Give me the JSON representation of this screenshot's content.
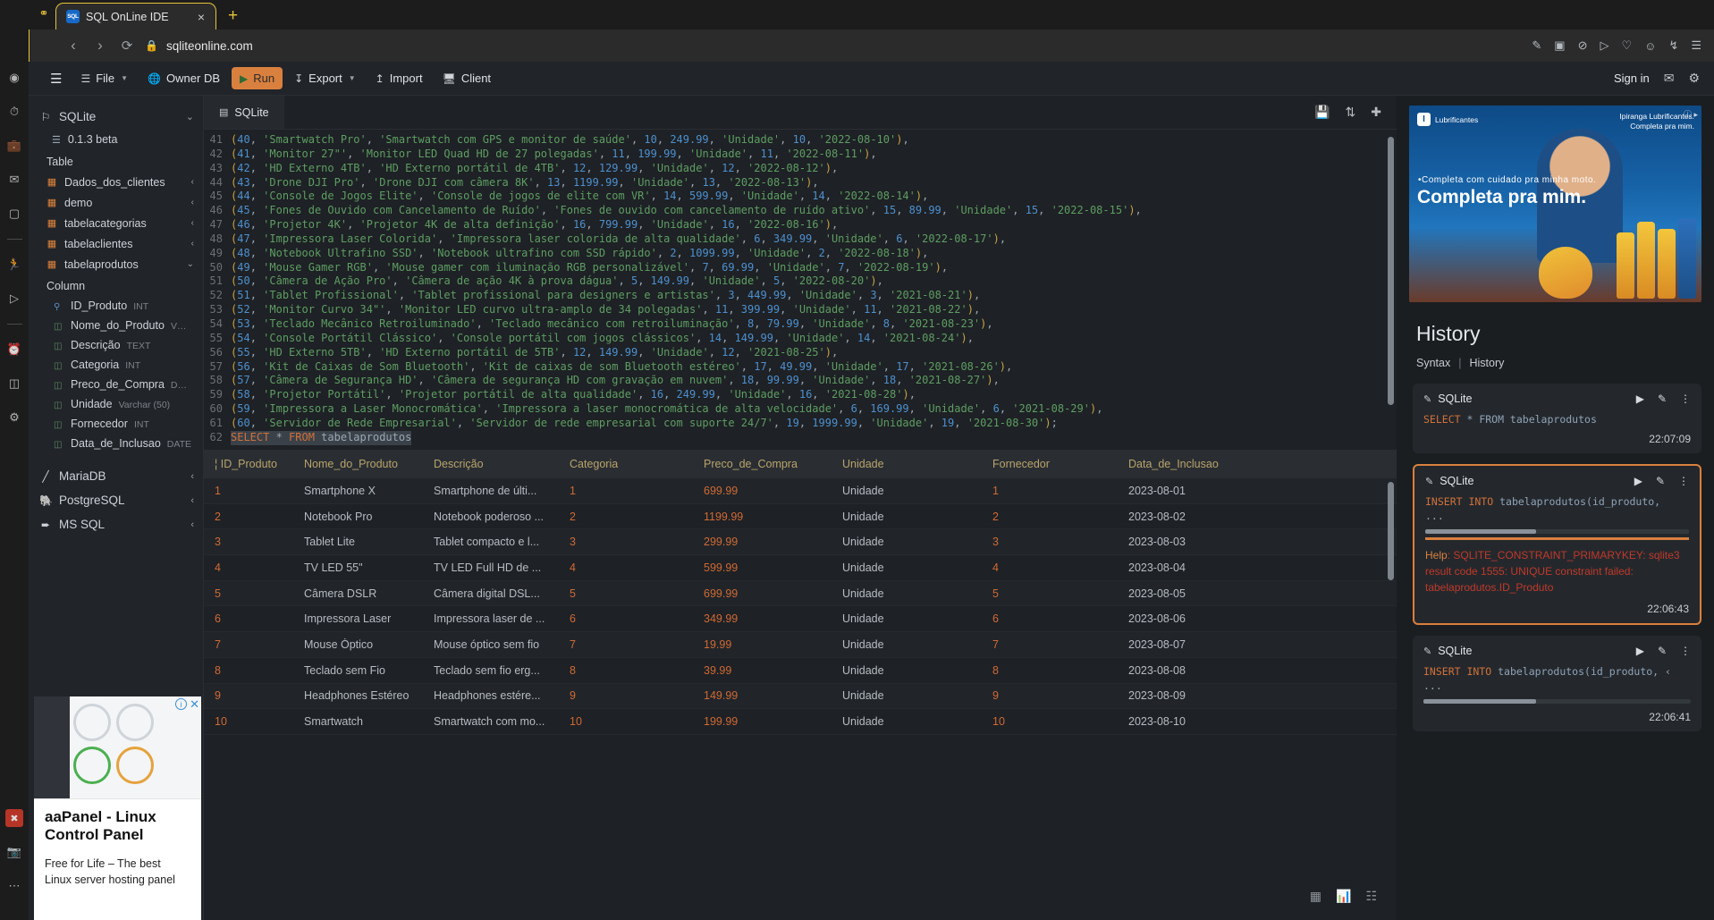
{
  "browser": {
    "tab": {
      "title": "SQL OnLine IDE",
      "favicon_text": "SQL",
      "close_icon": "×"
    },
    "new_tab_icon": "+",
    "left_icon": "bookmarks-icon",
    "nav": {
      "back": "‹",
      "forward": "›",
      "reload": "⟳",
      "lock": "🔒"
    },
    "url": "sqliteonline.com",
    "actions": [
      "edit-icon",
      "image-icon",
      "block-icon",
      "cast-icon",
      "send-icon",
      "heart-icon",
      "profile-icon",
      "download-icon",
      "menu-icon"
    ]
  },
  "launcher": {
    "items": [
      "opera-icon",
      "speed-dial-icon",
      "suitcase-icon",
      "messenger-icon",
      "instagram-icon",
      "divider",
      "fitness-icon",
      "player-icon",
      "divider2",
      "clock-icon",
      "cube-icon",
      "settings-icon"
    ],
    "bottom": [
      "red-icon",
      "camera-icon",
      "more-icon"
    ]
  },
  "toolbar": {
    "hamburger_icon": "☰",
    "file_label": "File",
    "owner_db_label": "Owner DB",
    "run_label": "Run",
    "export_label": "Export",
    "import_label": "Import",
    "client_label": "Client",
    "sign_in_label": "Sign in",
    "mail_icon": "✉",
    "gear_icon": "⚙"
  },
  "sidebar": {
    "database": {
      "name": "SQLite",
      "icon": "flag-icon",
      "chevron": "⌄"
    },
    "version": {
      "label": "0.1.3 beta",
      "icon": "schema-icon"
    },
    "table_section_label": "Table",
    "tables": [
      {
        "name": "Dados_dos_clientes",
        "expanded": false,
        "chevron": "‹"
      },
      {
        "name": "demo",
        "expanded": false,
        "chevron": "‹"
      },
      {
        "name": "tabelacategorias",
        "expanded": false,
        "chevron": "‹"
      },
      {
        "name": "tabelaclientes",
        "expanded": false,
        "chevron": "‹"
      },
      {
        "name": "tabelaprodutos",
        "expanded": true,
        "chevron": "⌄"
      }
    ],
    "column_section_label": "Column",
    "columns": [
      {
        "name": "ID_Produto",
        "type": "INT",
        "key": true
      },
      {
        "name": "Nome_do_Produto",
        "type": "V…",
        "key": false
      },
      {
        "name": "Descrição",
        "type": "TEXT",
        "key": false
      },
      {
        "name": "Categoria",
        "type": "INT",
        "key": false
      },
      {
        "name": "Preco_de_Compra",
        "type": "D…",
        "key": false
      },
      {
        "name": "Unidade",
        "type": "Varchar (50)",
        "key": false
      },
      {
        "name": "Fornecedor",
        "type": "INT",
        "key": false
      },
      {
        "name": "Data_de_Inclusao",
        "type": "DATE",
        "key": false
      }
    ],
    "other_databases": [
      {
        "name": "MariaDB",
        "icon": "mariadb-icon",
        "chevron": "‹"
      },
      {
        "name": "PostgreSQL",
        "icon": "postgres-icon",
        "chevron": "‹"
      },
      {
        "name": "MS SQL",
        "icon": "mssql-icon",
        "chevron": "‹"
      }
    ],
    "ad": {
      "title": "aaPanel - Linux Control Panel",
      "subtitle": "Free for Life – The best Linux server hosting panel",
      "info_icon": "i",
      "close_icon": "✕"
    }
  },
  "editor": {
    "tab_label": "SQLite",
    "tab_icon": "db-icon",
    "tab_actions": [
      "save-icon",
      "refresh-icon",
      "add-icon"
    ],
    "lines": [
      {
        "n": 41,
        "text": "(40, 'Smartwatch Pro', 'Smartwatch com GPS e monitor de saúde', 10, 249.99, 'Unidade', 10, '2022-08-10'),"
      },
      {
        "n": 42,
        "text": "(41, 'Monitor 27\"', 'Monitor LED Quad HD de 27 polegadas', 11, 199.99, 'Unidade', 11, '2022-08-11'),"
      },
      {
        "n": 43,
        "text": "(42, 'HD Externo 4TB', 'HD Externo portátil de 4TB', 12, 129.99, 'Unidade', 12, '2022-08-12'),"
      },
      {
        "n": 44,
        "text": "(43, 'Drone DJI Pro', 'Drone DJI com câmera 8K', 13, 1199.99, 'Unidade', 13, '2022-08-13'),"
      },
      {
        "n": 45,
        "text": "(44, 'Console de Jogos Elite', 'Console de jogos de elite com VR', 14, 599.99, 'Unidade', 14, '2022-08-14'),"
      },
      {
        "n": 46,
        "text": "(45, 'Fones de Ouvido com Cancelamento de Ruído', 'Fones de ouvido com cancelamento de ruído ativo', 15, 89.99, 'Unidade', 15, '2022-08-15'),"
      },
      {
        "n": 47,
        "text": "(46, 'Projetor 4K', 'Projetor 4K de alta definição', 16, 799.99, 'Unidade', 16, '2022-08-16'),"
      },
      {
        "n": 48,
        "text": "(47, 'Impressora Laser Colorida', 'Impressora laser colorida de alta qualidade', 6, 349.99, 'Unidade', 6, '2022-08-17'),"
      },
      {
        "n": 49,
        "text": "(48, 'Notebook Ultrafino SSD', 'Notebook ultrafino com SSD rápido', 2, 1099.99, 'Unidade', 2, '2022-08-18'),"
      },
      {
        "n": 50,
        "text": "(49, 'Mouse Gamer RGB', 'Mouse gamer com iluminação RGB personalizável', 7, 69.99, 'Unidade', 7, '2022-08-19'),"
      },
      {
        "n": 51,
        "text": "(50, 'Câmera de Ação Pro', 'Câmera de ação 4K à prova dágua', 5, 149.99, 'Unidade', 5, '2022-08-20'),"
      },
      {
        "n": 52,
        "text": "(51, 'Tablet Profissional', 'Tablet profissional para designers e artistas', 3, 449.99, 'Unidade', 3, '2021-08-21'),"
      },
      {
        "n": 53,
        "text": "(52, 'Monitor Curvo 34\"', 'Monitor LED curvo ultra-amplo de 34 polegadas', 11, 399.99, 'Unidade', 11, '2021-08-22'),"
      },
      {
        "n": 54,
        "text": "(53, 'Teclado Mecânico Retroiluminado', 'Teclado mecânico com retroiluminação', 8, 79.99, 'Unidade', 8, '2021-08-23'),"
      },
      {
        "n": 55,
        "text": "(54, 'Console Portátil Clássico', 'Console portátil com jogos clássicos', 14, 149.99, 'Unidade', 14, '2021-08-24'),"
      },
      {
        "n": 56,
        "text": "(55, 'HD Externo 5TB', 'HD Externo portátil de 5TB', 12, 149.99, 'Unidade', 12, '2021-08-25'),"
      },
      {
        "n": 57,
        "text": "(56, 'Kit de Caixas de Som Bluetooth', 'Kit de caixas de som Bluetooth estéreo', 17, 49.99, 'Unidade', 17, '2021-08-26'),"
      },
      {
        "n": 58,
        "text": "(57, 'Câmera de Segurança HD', 'Câmera de segurança HD com gravação em nuvem', 18, 99.99, 'Unidade', 18, '2021-08-27'),"
      },
      {
        "n": 59,
        "text": "(58, 'Projetor Portátil', 'Projetor portátil de alta qualidade', 16, 249.99, 'Unidade', 16, '2021-08-28'),"
      },
      {
        "n": 60,
        "text": "(59, 'Impressora a Laser Monocromática', 'Impressora a laser monocromática de alta velocidade', 6, 169.99, 'Unidade', 6, '2021-08-29'),"
      },
      {
        "n": 61,
        "text": "(60, 'Servidor de Rede Empresarial', 'Servidor de rede empresarial com suporte 24/7', 19, 1999.99, 'Unidade', 19, '2021-08-30');"
      },
      {
        "n": 62,
        "text": "SELECT * FROM tabelaprodutos",
        "selected": true
      }
    ]
  },
  "results": {
    "columns": [
      "ID_Produto",
      "Nome_do_Produto",
      "Descrição",
      "Categoria",
      "Preco_de_Compra",
      "Unidade",
      "Fornecedor",
      "Data_de_Inclusao"
    ],
    "rows": [
      [
        "1",
        "Smartphone X",
        "Smartphone de últi...",
        "1",
        "699.99",
        "Unidade",
        "1",
        "2023-08-01"
      ],
      [
        "2",
        "Notebook Pro",
        "Notebook poderoso ...",
        "2",
        "1199.99",
        "Unidade",
        "2",
        "2023-08-02"
      ],
      [
        "3",
        "Tablet Lite",
        "Tablet compacto e l...",
        "3",
        "299.99",
        "Unidade",
        "3",
        "2023-08-03"
      ],
      [
        "4",
        "TV LED 55\"",
        "TV LED Full HD de ...",
        "4",
        "599.99",
        "Unidade",
        "4",
        "2023-08-04"
      ],
      [
        "5",
        "Câmera DSLR",
        "Câmera digital DSL...",
        "5",
        "699.99",
        "Unidade",
        "5",
        "2023-08-05"
      ],
      [
        "6",
        "Impressora Laser",
        "Impressora laser de ...",
        "6",
        "349.99",
        "Unidade",
        "6",
        "2023-08-06"
      ],
      [
        "7",
        "Mouse Óptico",
        "Mouse óptico sem fio",
        "7",
        "19.99",
        "Unidade",
        "7",
        "2023-08-07"
      ],
      [
        "8",
        "Teclado sem Fio",
        "Teclado sem fio erg...",
        "8",
        "39.99",
        "Unidade",
        "8",
        "2023-08-08"
      ],
      [
        "9",
        "Headphones Estéreo",
        "Headphones estére...",
        "9",
        "149.99",
        "Unidade",
        "9",
        "2023-08-09"
      ],
      [
        "10",
        "Smartwatch",
        "Smartwatch com mo...",
        "10",
        "199.99",
        "Unidade",
        "10",
        "2023-08-10"
      ]
    ],
    "footer_tools": [
      "grid-view-icon",
      "chart-view-icon",
      "export-icon"
    ]
  },
  "right_panel": {
    "ad": {
      "brand": "Lubrificantes",
      "brand_mark": "I",
      "slogan_line1": "Ipiranga Lubrificantes.",
      "slogan_line2": "Completa pra mim.",
      "head": "•Completa com cuidado pra minha moto.",
      "big": "Completa pra mim.",
      "adchoices": "ⓘ ▸"
    },
    "title": "History",
    "tabs": {
      "syntax": "Syntax",
      "separator": "|",
      "history": "History"
    },
    "cards": [
      {
        "name": "SQLite",
        "sql_kw": "SELECT",
        "sql_rest": " * FROM tabelaprodutos",
        "time": "22:07:09",
        "error": false,
        "has_dots": false,
        "has_bar": false
      },
      {
        "name": "SQLite",
        "sql_kw": "INSERT INTO",
        "sql_rest": " tabelaprodutos(id_produto,",
        "dots": "...",
        "time": "22:06:43",
        "error": true,
        "has_dots": true,
        "has_bar": true,
        "help_label": "Help",
        "help_text": ": SQLITE_CONSTRAINT_PRIMARYKEY: sqlite3 result code 1555: UNIQUE constraint failed: tabelaprodutos.ID_Produto"
      },
      {
        "name": "SQLite",
        "sql_kw": "INSERT INTO",
        "sql_rest": " tabelaprodutos(id_produto, ‹",
        "dots": "...",
        "time": "22:06:41",
        "error": false,
        "has_dots": true,
        "has_bar": true
      }
    ],
    "card_actions": {
      "run": "▶",
      "edit": "✎",
      "more": "⋮"
    }
  },
  "colors": {
    "accent": "#d9803f",
    "error": "#c0392b",
    "tab_border": "#e8c33a",
    "string": "#5e9e63",
    "number": "#4d90cf"
  }
}
